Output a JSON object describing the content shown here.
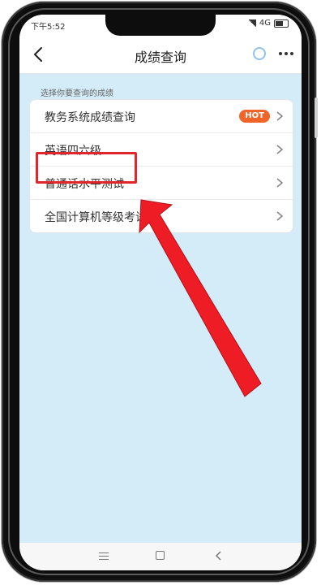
{
  "status_bar": {
    "time": "下午5:52",
    "network": "4G",
    "battery_icon": "battery-icon",
    "signal_icon": "signal-icon"
  },
  "header": {
    "title": "成绩查询",
    "back_icon": "chevron-left-icon",
    "more_icon": "more-dots-icon",
    "circle_icon": "circle-icon"
  },
  "section_label": "选择你要查询的成绩",
  "list": {
    "items": [
      {
        "label": "教务系统成绩查询",
        "badge": "HOT"
      },
      {
        "label": "英语四六级"
      },
      {
        "label": "普通话水平测试"
      },
      {
        "label": "全国计算机等级考试"
      }
    ]
  },
  "annotation": {
    "highlight_color": "#e0262b",
    "arrow_color": "#ee1c24"
  },
  "system_nav": [
    "menu-icon",
    "home-icon",
    "back-icon"
  ]
}
